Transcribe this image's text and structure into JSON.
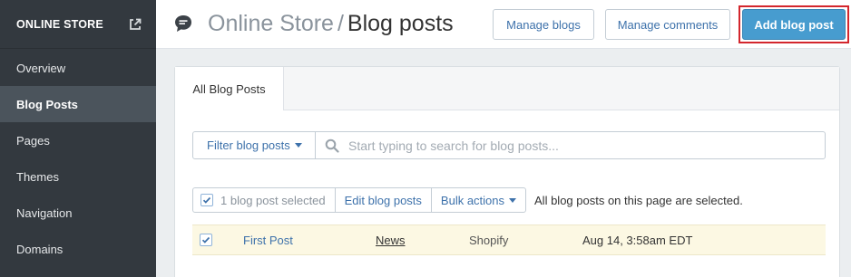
{
  "sidebar": {
    "title": "ONLINE STORE",
    "items": [
      {
        "label": "Overview"
      },
      {
        "label": "Blog Posts"
      },
      {
        "label": "Pages"
      },
      {
        "label": "Themes"
      },
      {
        "label": "Navigation"
      },
      {
        "label": "Domains"
      }
    ],
    "active_item": "Blog Posts"
  },
  "header": {
    "breadcrumb_parent": "Online Store",
    "separator": "/",
    "page_title": "Blog posts",
    "buttons": {
      "manage_blogs": "Manage blogs",
      "manage_comments": "Manage comments",
      "add_blog_post": "Add blog post"
    }
  },
  "tabs": [
    {
      "label": "All Blog Posts",
      "selected": true
    }
  ],
  "filter": {
    "button_label": "Filter blog posts",
    "search_placeholder": "Start typing to search for blog posts..."
  },
  "bulk": {
    "selected_label": "1 blog post selected",
    "edit_label": "Edit blog posts",
    "actions_label": "Bulk actions",
    "note": "All blog posts on this page are selected."
  },
  "posts": [
    {
      "title": "First Post",
      "blog": "News",
      "author": "Shopify",
      "date": "Aug 14, 3:58am EDT",
      "checked": true
    }
  ],
  "colors": {
    "sidebar_bg": "#33393f",
    "sidebar_active": "#4b545c",
    "primary": "#479ccf",
    "link": "#3e72ab",
    "highlight_outline": "#d3262d",
    "selected_row_bg": "#fcf8e3"
  },
  "icons": {
    "sidebar_external": "external-link-icon",
    "header": "chat-bubble-icon",
    "search": "search-icon",
    "checkbox": "check-icon",
    "dropdown": "caret-down-icon"
  }
}
